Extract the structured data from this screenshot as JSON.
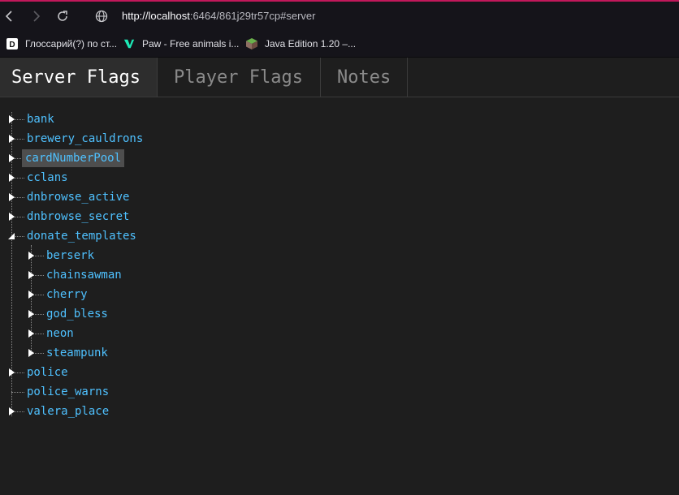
{
  "browser": {
    "url_host": "http://localhost",
    "url_rest": ":6464/861j29tr57cp#server"
  },
  "bookmarks": [
    {
      "label": "Глоссарий(?) по ст...",
      "icon": "d-square-icon"
    },
    {
      "label": "Paw - Free animals i...",
      "icon": "paw-logo-icon"
    },
    {
      "label": "Java Edition 1.20 –...",
      "icon": "grass-block-icon"
    }
  ],
  "tabs": [
    {
      "label": "Server Flags",
      "active": true
    },
    {
      "label": "Player Flags",
      "active": false
    },
    {
      "label": "Notes",
      "active": false
    }
  ],
  "tree": {
    "nodes": [
      {
        "label": "bank",
        "expandable": true,
        "expanded": false,
        "selected": false
      },
      {
        "label": "brewery_cauldrons",
        "expandable": true,
        "expanded": false,
        "selected": false
      },
      {
        "label": "cardNumberPool",
        "expandable": true,
        "expanded": false,
        "selected": true
      },
      {
        "label": "cclans",
        "expandable": true,
        "expanded": false,
        "selected": false
      },
      {
        "label": "dnbrowse_active",
        "expandable": true,
        "expanded": false,
        "selected": false
      },
      {
        "label": "dnbrowse_secret",
        "expandable": true,
        "expanded": false,
        "selected": false
      },
      {
        "label": "donate_templates",
        "expandable": true,
        "expanded": true,
        "selected": false,
        "children": [
          {
            "label": "berserk",
            "expandable": true
          },
          {
            "label": "chainsawman",
            "expandable": true
          },
          {
            "label": "cherry",
            "expandable": true
          },
          {
            "label": "god_bless",
            "expandable": true
          },
          {
            "label": "neon",
            "expandable": true
          },
          {
            "label": "steampunk",
            "expandable": true
          }
        ]
      },
      {
        "label": "police",
        "expandable": true,
        "expanded": false,
        "selected": false
      },
      {
        "label": "police_warns",
        "expandable": false,
        "expanded": false,
        "selected": false
      },
      {
        "label": "valera_place",
        "expandable": true,
        "expanded": false,
        "selected": false
      }
    ]
  },
  "colors": {
    "link": "#4fc1ff",
    "background": "#1e1e1e",
    "selected_bg": "#4e4e4e",
    "accent": "#c2185b"
  }
}
